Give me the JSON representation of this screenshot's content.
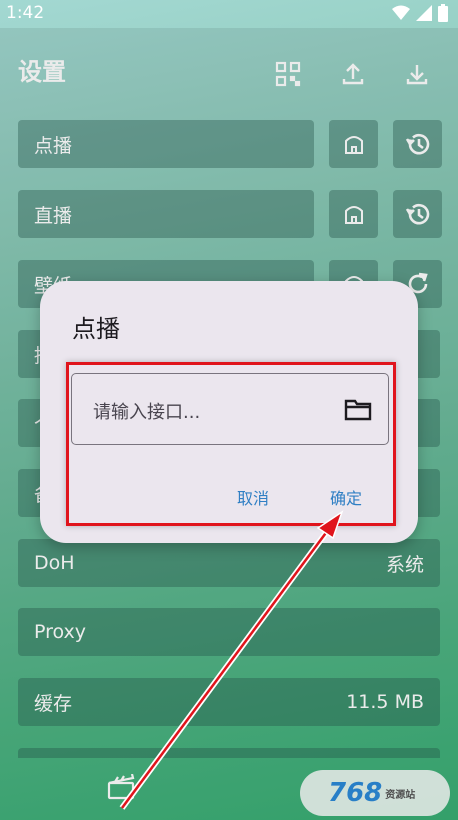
{
  "status_bar": {
    "time": "1:42"
  },
  "header": {
    "title": "设置",
    "icons": [
      "qr-code-icon",
      "upload-icon",
      "download-icon"
    ]
  },
  "rows": [
    {
      "label": "点播",
      "value": ""
    },
    {
      "label": "直播",
      "value": ""
    },
    {
      "label": "壁纸",
      "value": ""
    },
    {
      "label": "播",
      "value": ""
    },
    {
      "label": "个",
      "value": ""
    },
    {
      "label": "备",
      "value": ""
    },
    {
      "label": "DoH",
      "value": "系统"
    },
    {
      "label": "Proxy",
      "value": ""
    },
    {
      "label": "缓存",
      "value": "11.5 MB"
    }
  ],
  "dialog": {
    "title": "点播",
    "input_placeholder": "请输入接口...",
    "cancel": "取消",
    "confirm": "确定"
  },
  "watermark": {
    "text": "768",
    "sub": "资源站"
  },
  "colors": {
    "accent": "#2f7fc4",
    "highlight": "#e0141c"
  }
}
